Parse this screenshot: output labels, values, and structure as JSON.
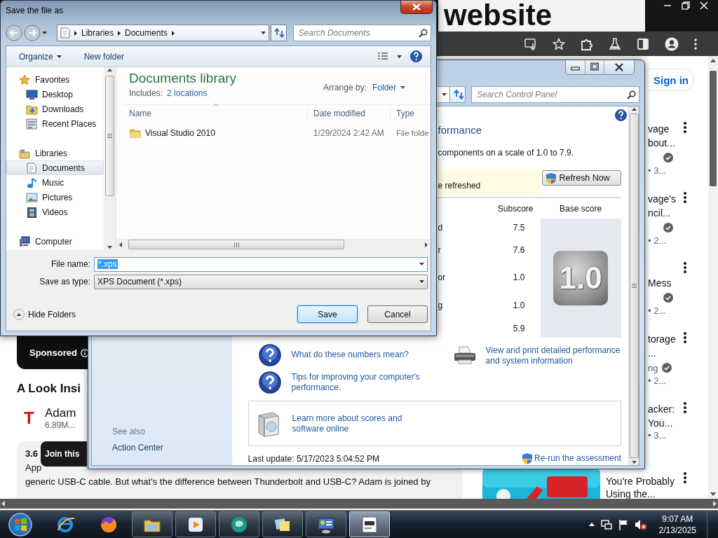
{
  "browser": {
    "logo_text": "website",
    "sign_in": "Sign in",
    "sponsored": "Sponsored",
    "video_title": "A Look Insi",
    "channel": {
      "initial": "T",
      "name": "Adam",
      "subscribers": "6.89M..."
    },
    "description": [
      "3.6",
      "App",
      "generic USB-C cable. But what's the difference between Thunderbolt and USB-C? Adam is joined by"
    ],
    "join_button": "Join this",
    "recommendations": [
      {
        "kind": "covered",
        "lines": [
          "vage",
          "bout..."
        ],
        "verified": true,
        "meta": "• 3..."
      },
      {
        "kind": "covered",
        "lines": [
          "vage's",
          "ncil..."
        ],
        "verified": true,
        "meta": "• 2..."
      },
      {
        "kind": "covered",
        "lines": [
          "Mess"
        ],
        "verified": true,
        "meta": "• 2..."
      },
      {
        "kind": "covered",
        "lines": [
          "torage",
          "..."
        ],
        "channel": "ng",
        "verified": true,
        "meta": "• 2..."
      },
      {
        "kind": "covered",
        "lines": [
          "acker:",
          "You..."
        ],
        "verified": false,
        "meta": "• 3..."
      },
      {
        "kind": "picture",
        "lines": [
          "You're Probably",
          "Using the..."
        ]
      }
    ]
  },
  "control_panel": {
    "search_placeholder": "Search Control Panel",
    "title": "formance",
    "description": "components on a scale of 1.0 to 7.9.",
    "notice": "e refreshed",
    "refresh_button": "Refresh Now",
    "columns": [
      "Subscore",
      "Base score"
    ],
    "rows": [
      {
        "label": "d",
        "subscore": "7.5"
      },
      {
        "label": "r",
        "subscore": "7.6"
      },
      {
        "label": "or",
        "subscore": "1.0"
      },
      {
        "label": "g",
        "subscore": "1.0"
      },
      {
        "subscore": "5.9"
      }
    ],
    "base_score": "1.0",
    "links": [
      "What do these numbers mean?",
      "Tips for improving your computer's performance."
    ],
    "print_link": "View and print detailed performance and system information",
    "learn_link": "Learn more about scores and software online",
    "last_update": "Last update: 5/17/2023 5:04:52 PM",
    "rerun_link": "Re-run the assessment",
    "see_also": "See also",
    "see_also_links": [
      "Action Center"
    ]
  },
  "dialog": {
    "title": "Save the file as",
    "breadcrumb": [
      "Libraries",
      "Documents"
    ],
    "search_placeholder": "Search Documents",
    "toolbar": [
      "Organize",
      "New folder"
    ],
    "nav": [
      {
        "label": "Favorites",
        "selected": false,
        "children": [
          {
            "label": "Desktop",
            "selected": false
          },
          {
            "label": "Downloads",
            "selected": false
          },
          {
            "label": "Recent Places",
            "selected": false
          }
        ]
      },
      {
        "label": "Libraries",
        "selected": false,
        "children": [
          {
            "label": "Documents",
            "selected": true
          },
          {
            "label": "Music",
            "selected": false
          },
          {
            "label": "Pictures",
            "selected": false
          },
          {
            "label": "Videos",
            "selected": false
          }
        ]
      },
      {
        "label": "Computer",
        "selected": false
      }
    ],
    "library_title": "Documents library",
    "includes_label": "Includes:",
    "includes_link": "2 locations",
    "arrange_label": "Arrange by:",
    "arrange_value": "Folder",
    "columns": [
      "Name",
      "Date modified",
      "Type"
    ],
    "files": [
      {
        "name": "Visual Studio 2010",
        "date": "1/29/2024 2:42 AM",
        "type": "File folde"
      }
    ],
    "file_name_label": "File name:",
    "file_name": "*.xps",
    "type_label": "Save as type:",
    "type_value": "XPS Document (*.xps)",
    "hide_folders": "Hide Folders",
    "buttons": [
      {
        "label": "Save",
        "default": true
      },
      {
        "label": "Cancel",
        "default": false
      }
    ]
  },
  "taskbar": {
    "apps": [
      {
        "running": false,
        "selected": false
      },
      {
        "running": false,
        "selected": false
      },
      {
        "running": true,
        "selected": false
      },
      {
        "running": true,
        "selected": false
      },
      {
        "running": true,
        "selected": false
      },
      {
        "running": true,
        "selected": false
      },
      {
        "running": true,
        "selected": false
      },
      {
        "running": true,
        "selected": true
      }
    ],
    "time": "9:07 AM",
    "date": "2/13/2025"
  }
}
